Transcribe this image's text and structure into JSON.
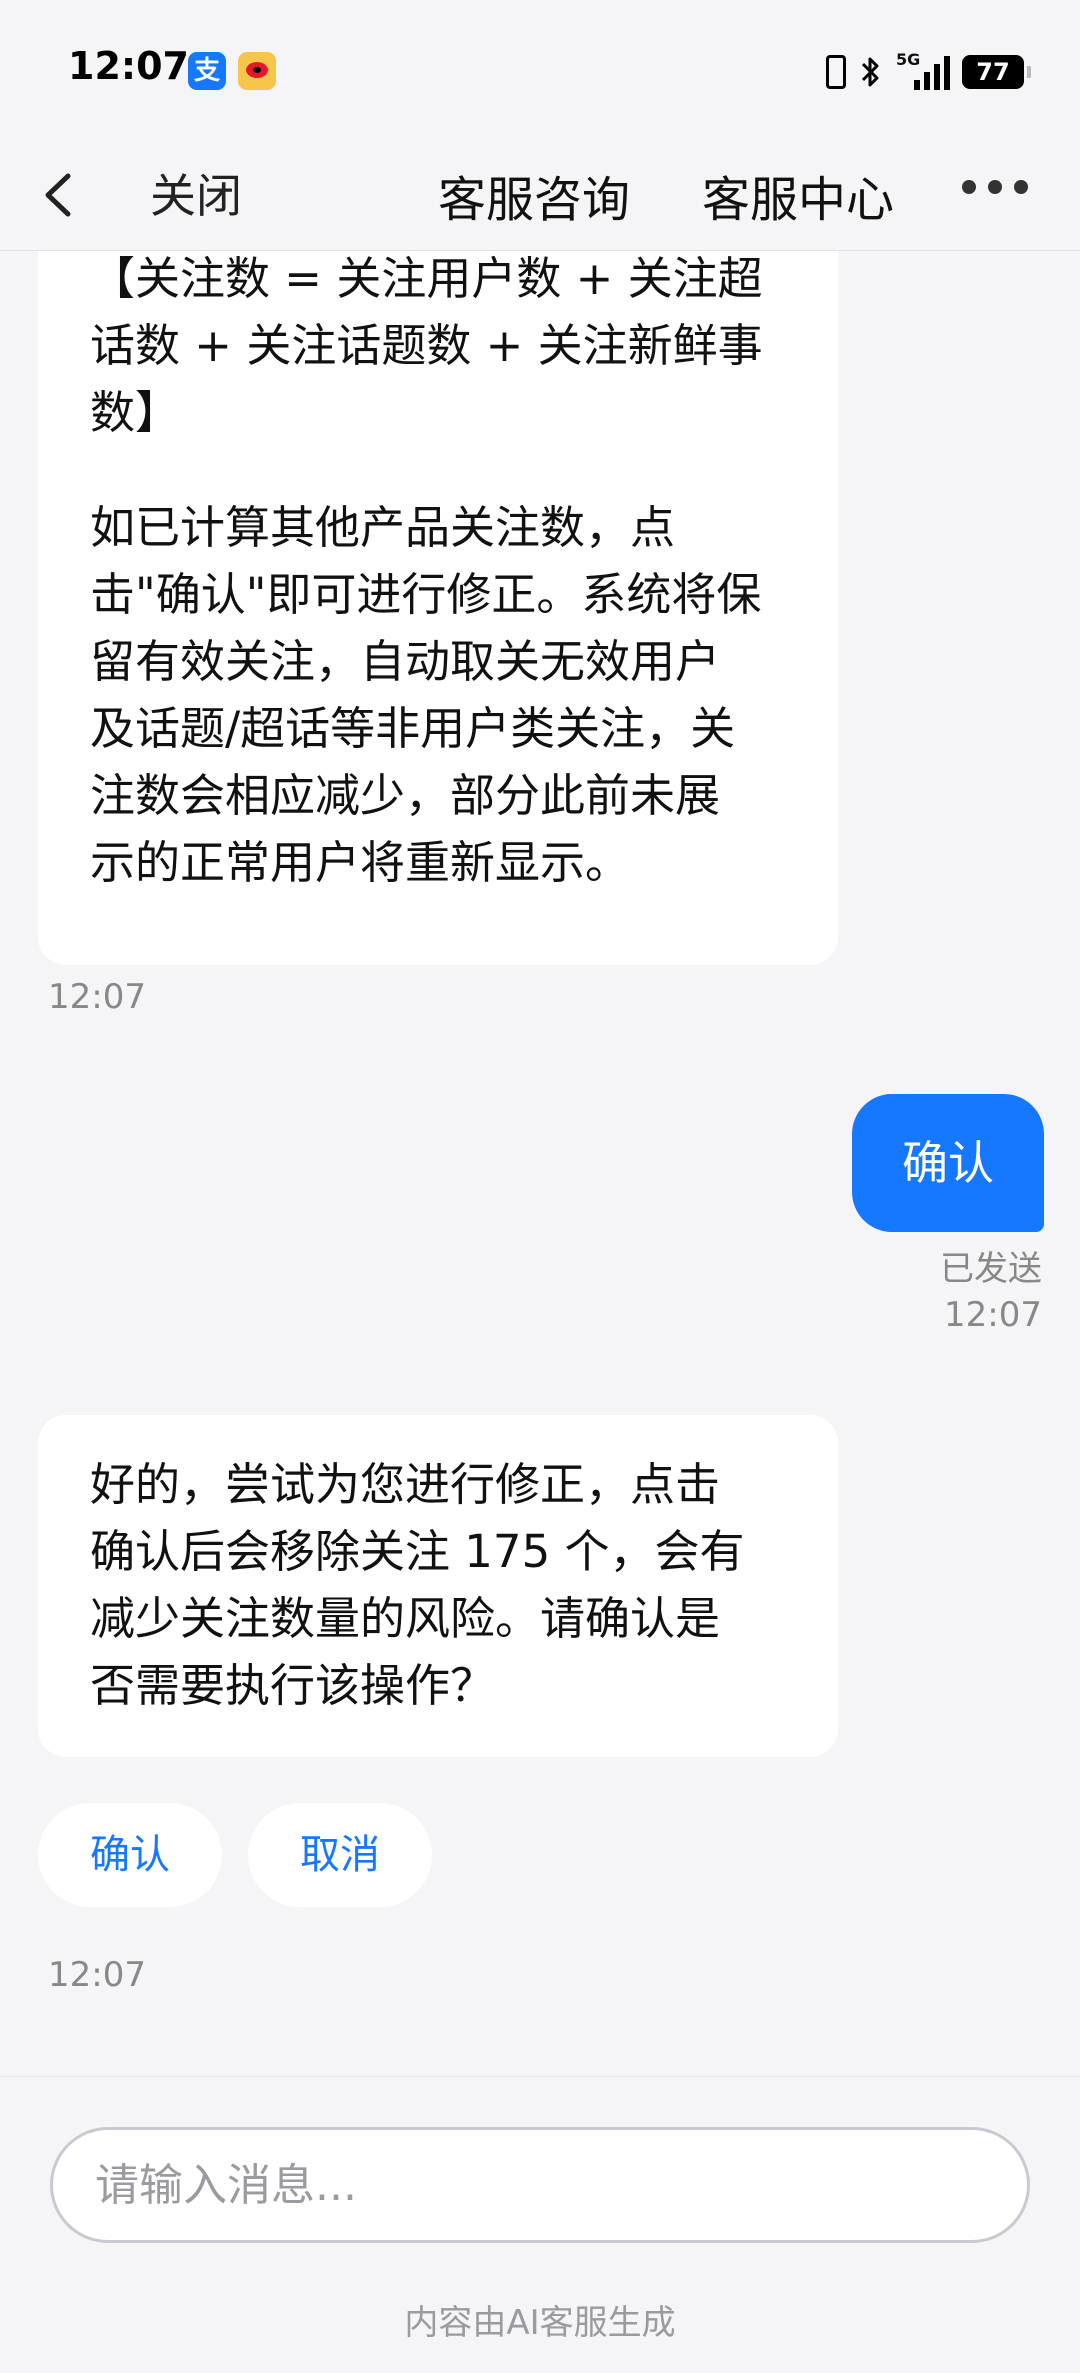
{
  "status_bar": {
    "time": "12:07",
    "alipay_glyph": "支",
    "network_label": "5G",
    "battery": "77"
  },
  "nav": {
    "close_label": "关闭",
    "title": "客服咨询",
    "center_label": "客服中心"
  },
  "messages": {
    "msg1_lines": [
      "【关注数 = 关注用户数 + 关注超",
      "话数 + 关注话题数 + 关注新鲜事",
      "数】"
    ],
    "msg1_para2": [
      "如已计算其他产品关注数，点",
      "击\"确认\"即可进行修正。系统将保",
      "留有效关注，自动取关无效用户",
      "及话题/超话等非用户类关注，关",
      "注数会相应减少，部分此前未展",
      "示的正常用户将重新显示。"
    ],
    "msg1_time": "12:07",
    "user_msg": "确认",
    "user_status": "已发送",
    "user_time": "12:07",
    "msg2_lines": [
      "好的，尝试为您进行修正，点击",
      "确认后会移除关注 175 个，会有",
      "减少关注数量的风险。请确认是",
      "否需要执行该操作？"
    ],
    "confirm_label": "确认",
    "cancel_label": "取消",
    "msg2_time": "12:07"
  },
  "footer": {
    "input_placeholder": "请输入消息...",
    "ai_note": "内容由AI客服生成"
  },
  "colors": {
    "accent": "#1677ff",
    "background": "#f5f5f7",
    "bubble": "#ffffff"
  }
}
